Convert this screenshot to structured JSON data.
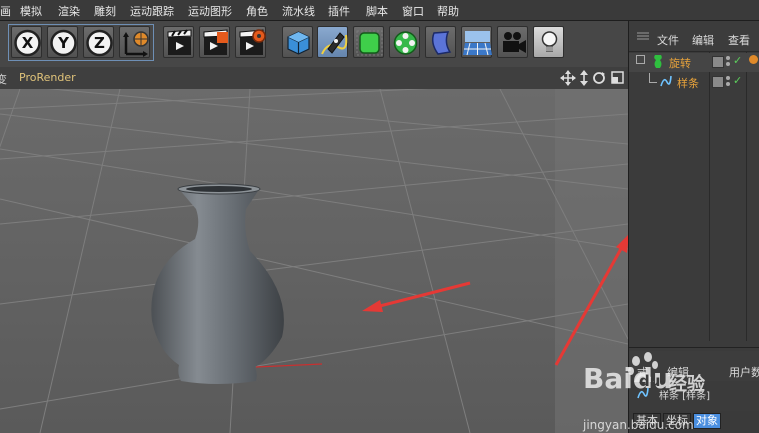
{
  "menu": [
    "画",
    "模拟",
    "渲染",
    "雕刻",
    "运动跟踪",
    "运动图形",
    "角色",
    "流水线",
    "插件",
    "脚本",
    "窗口",
    "帮助"
  ],
  "toolbar": {
    "axis_x": "X",
    "axis_y": "Y",
    "axis_z": "Z",
    "icons": [
      "x-axis-icon",
      "y-axis-icon",
      "z-axis-icon",
      "coordinate-system-icon",
      "render-view-icon",
      "render-picture-viewer-icon",
      "render-settings-icon",
      "cube-icon",
      "pen-spline-icon",
      "subdivision-icon",
      "mograph-cloner-icon",
      "deformer-icon",
      "floor-icon",
      "camera-icon",
      "light-icon"
    ]
  },
  "viewport": {
    "left_fragment": "变",
    "renderer": "ProRender",
    "nav_icons": [
      "move-view-icon",
      "zoom-view-icon",
      "rotate-view-icon",
      "maximize-view-icon"
    ]
  },
  "object_manager": {
    "menu": [
      "文件",
      "编辑",
      "查看"
    ],
    "objects": [
      {
        "name": "旋转",
        "color": "#e8a33b"
      },
      {
        "name": "样条",
        "color": "#e8a33b"
      }
    ]
  },
  "attributes": {
    "menu_fragment": "式",
    "menu": [
      "编辑",
      "用户数"
    ],
    "object_line": "样条 [样条]",
    "tabs": [
      "基本",
      "坐标",
      "对象"
    ],
    "active_tab": "对象"
  },
  "watermark": {
    "brand": "Baidu",
    "paw": "du",
    "subtitle": "经验",
    "url": "jingyan.baidu.com"
  },
  "colors": {
    "accent": "#4b8fe0",
    "label_orange": "#e8a33b",
    "annotation_red": "#e53935"
  }
}
